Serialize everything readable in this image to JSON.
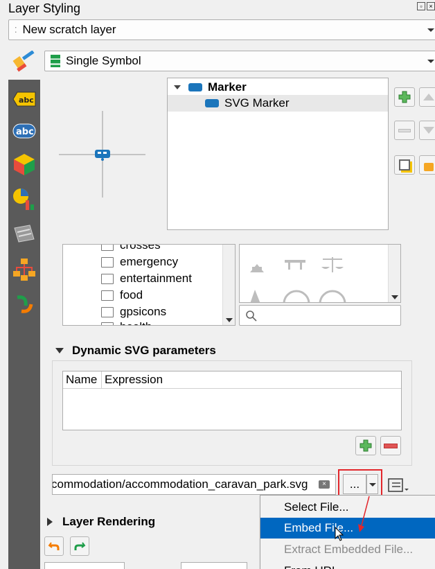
{
  "window": {
    "title": "Layer Styling"
  },
  "layer_combo": {
    "value": "New scratch layer"
  },
  "renderer_combo": {
    "value": "Single Symbol"
  },
  "symbol_tree": {
    "items": [
      {
        "label": "Marker"
      },
      {
        "label": "SVG Marker"
      }
    ]
  },
  "svg_groups": {
    "items": [
      "crosses",
      "emergency",
      "entertainment",
      "food",
      "gpsicons",
      "health"
    ]
  },
  "dynamic_svg": {
    "header": "Dynamic SVG parameters",
    "columns": [
      "Name",
      "Expression"
    ]
  },
  "svg_path": {
    "value": "commodation/accommodation_caravan_park.svg",
    "browse_label": "..."
  },
  "menu": {
    "items": [
      {
        "label": "Select File..."
      },
      {
        "label": "Embed File..."
      },
      {
        "label": "Extract Embedded File..."
      },
      {
        "label": "From URL"
      }
    ]
  },
  "layer_rendering": {
    "header": "Layer Rendering"
  },
  "colors": {
    "accent": "#0067c0",
    "highlight": "#e2262b",
    "sidebar": "#5a5a5a"
  }
}
